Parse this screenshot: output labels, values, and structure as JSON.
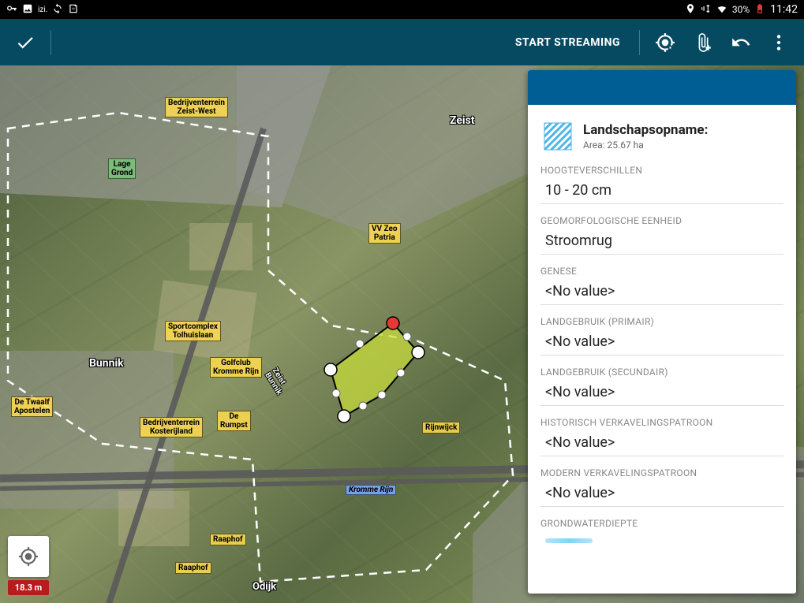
{
  "status": {
    "battery": "30%",
    "time": "11:42",
    "app_abbr": "izi."
  },
  "actionbar": {
    "stream_label": "START STREAMING"
  },
  "map": {
    "accuracy": "18.3 m",
    "labels": {
      "zeist": "Zeist",
      "bunnik": "Bunnik",
      "odijk": "Odijk",
      "lage_grond": "Lage\nGrond",
      "bedrijven_zeist": "Bedrijventerrein\nZeist-West",
      "vv_zeist": "VV Zeo\nPatria",
      "sportcomplex": "Sportcomplex\nTolhuislaan",
      "golfclub": "Golfclub\nKromme Rijn",
      "de_rumpst": "De\nRumpst",
      "rijnwijck": "Rijnwijck",
      "bedrijven_koster": "Bedrijventerrein\nKosterijland",
      "de_twaalf": "De Twaalf\nApostelen",
      "raaphof1": "Raaphof",
      "raaphof2": "Raaphof",
      "road_zeist_bunnik": "Zeist\nBunnik",
      "kromme_rijn": "Kromme Rijn"
    }
  },
  "panel": {
    "feature_name": "Landschapsopname:",
    "feature_area": "Area: 25.67 ha",
    "fields": [
      {
        "label": "HOOGTEVERSCHILLEN",
        "value": "10 - 20 cm"
      },
      {
        "label": "GEOMORFOLOGISCHE EENHEID",
        "value": "Stroomrug"
      },
      {
        "label": "GENESE",
        "value": "<No value>"
      },
      {
        "label": "LANDGEBRUIK (PRIMAIR)",
        "value": "<No value>"
      },
      {
        "label": "LANDGEBRUIK (SECUNDAIR)",
        "value": "<No value>"
      },
      {
        "label": "HISTORISCH VERKAVELINGSPATROON",
        "value": "<No value>"
      },
      {
        "label": "MODERN VERKAVELINGSPATROON",
        "value": "<No value>"
      },
      {
        "label": "GRONDWATERDIEPTE",
        "value": null
      }
    ]
  }
}
